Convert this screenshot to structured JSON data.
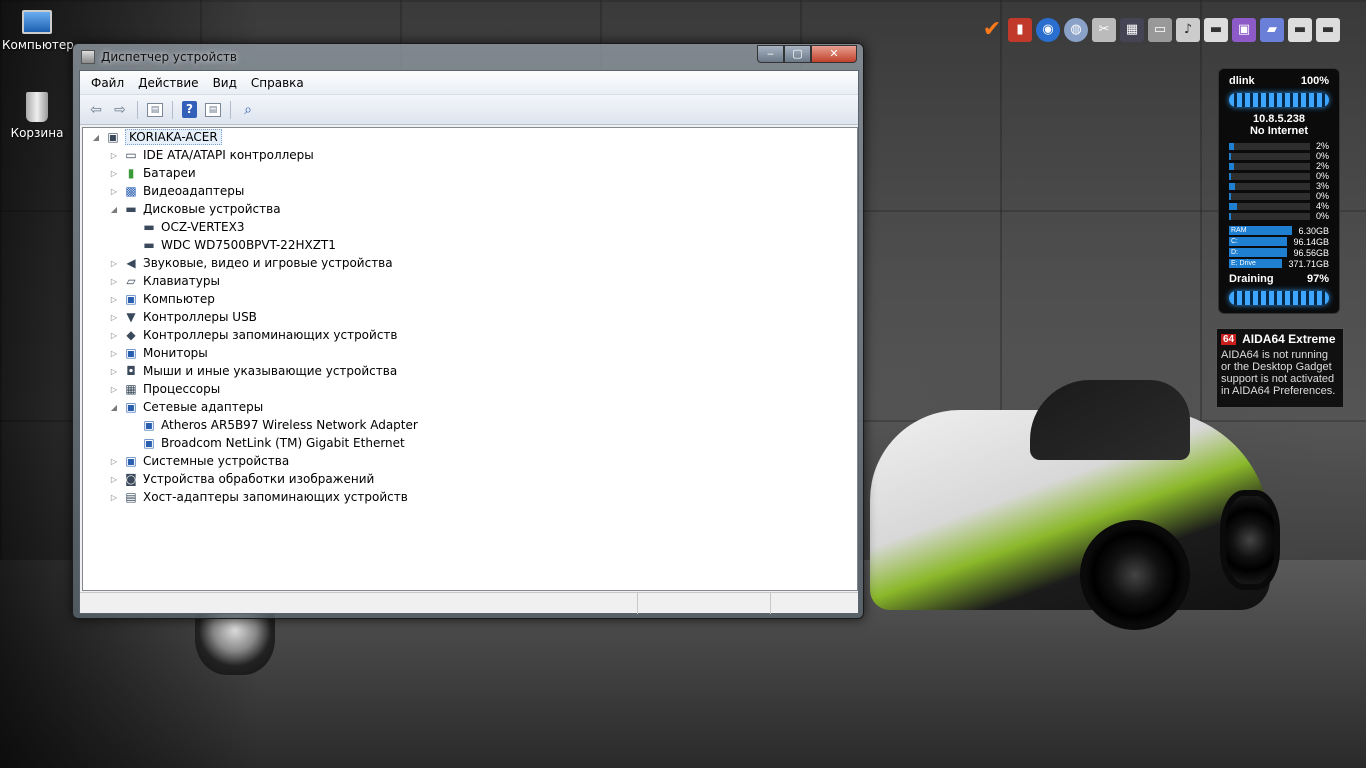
{
  "desktop": {
    "icons": [
      {
        "label": "Компьютер"
      },
      {
        "label": "Корзина"
      }
    ]
  },
  "gadget": {
    "network_name": "dlink",
    "signal": "100%",
    "ip": "10.8.5.238",
    "status": "No Internet",
    "cpu_cores": [
      "2%",
      "0%",
      "2%",
      "0%",
      "3%",
      "0%",
      "4%",
      "0%"
    ],
    "cpu_fill": [
      0.02,
      0.0,
      0.02,
      0.0,
      0.03,
      0.0,
      0.04,
      0.0
    ],
    "memory": [
      {
        "label": "RAM",
        "value": "6.30GB"
      },
      {
        "label": "C:",
        "value": "96.14GB"
      },
      {
        "label": "D:",
        "value": "96.56GB"
      },
      {
        "label": "E: Drive",
        "value": "371.71GB"
      }
    ],
    "battery_label": "Draining",
    "battery_value": "97%"
  },
  "aida": {
    "logo": "64",
    "title": "AIDA64 Extreme",
    "message": "AIDA64 is not running or the Desktop Gadget support is not activated in AIDA64 Preferences."
  },
  "window": {
    "title": "Диспетчер устройств",
    "menu": [
      "Файл",
      "Действие",
      "Вид",
      "Справка"
    ],
    "root": "KORIAKA-ACER",
    "categories": [
      {
        "label": "IDE ATA/ATAPI контроллеры",
        "expanded": false,
        "icon": "ide-controller-icon"
      },
      {
        "label": "Батареи",
        "expanded": false,
        "icon": "battery-icon"
      },
      {
        "label": "Видеоадаптеры",
        "expanded": false,
        "icon": "display-adapter-icon"
      },
      {
        "label": "Дисковые устройства",
        "expanded": true,
        "icon": "disk-drive-icon",
        "children": [
          "OCZ-VERTEX3",
          "WDC WD7500BPVT-22HXZT1"
        ]
      },
      {
        "label": "Звуковые, видео и игровые устройства",
        "expanded": false,
        "icon": "sound-icon"
      },
      {
        "label": "Клавиатуры",
        "expanded": false,
        "icon": "keyboard-icon"
      },
      {
        "label": "Компьютер",
        "expanded": false,
        "icon": "computer-icon"
      },
      {
        "label": "Контроллеры USB",
        "expanded": false,
        "icon": "usb-icon"
      },
      {
        "label": "Контроллеры запоминающих устройств",
        "expanded": false,
        "icon": "storage-controller-icon"
      },
      {
        "label": "Мониторы",
        "expanded": false,
        "icon": "monitor-icon"
      },
      {
        "label": "Мыши и иные указывающие устройства",
        "expanded": false,
        "icon": "mouse-icon"
      },
      {
        "label": "Процессоры",
        "expanded": false,
        "icon": "processor-icon"
      },
      {
        "label": "Сетевые адаптеры",
        "expanded": true,
        "icon": "network-adapter-icon",
        "children": [
          "Atheros AR5B97 Wireless Network Adapter",
          "Broadcom NetLink (TM) Gigabit Ethernet"
        ]
      },
      {
        "label": "Системные устройства",
        "expanded": false,
        "icon": "system-device-icon"
      },
      {
        "label": "Устройства обработки изображений",
        "expanded": false,
        "icon": "imaging-device-icon"
      },
      {
        "label": "Хост-адаптеры запоминающих устройств",
        "expanded": false,
        "icon": "storage-host-adapter-icon"
      }
    ]
  }
}
